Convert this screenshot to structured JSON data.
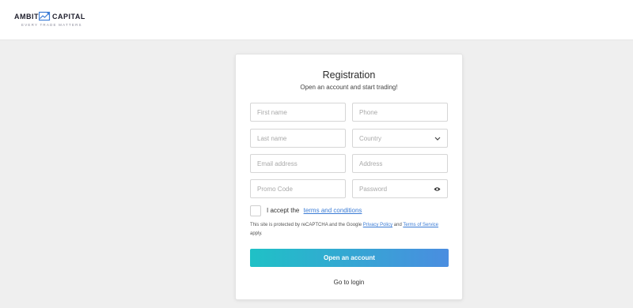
{
  "brand": {
    "name_left": "AMBIT",
    "name_right": "CAPITAL",
    "tagline": "EVERY TRADE MATTERS",
    "logo_icon": "chart-trend-icon",
    "color": "#3a7bd5"
  },
  "form": {
    "title": "Registration",
    "subtitle": "Open an account and start trading!",
    "fields": {
      "first_name": {
        "placeholder": "First name",
        "value": ""
      },
      "phone": {
        "placeholder": "Phone",
        "value": ""
      },
      "last_name": {
        "placeholder": "Last name",
        "value": ""
      },
      "country": {
        "selected": "Country",
        "icon": "chevron-down-icon"
      },
      "email": {
        "placeholder": "Email address",
        "value": ""
      },
      "address": {
        "placeholder": "Address",
        "value": ""
      },
      "promo": {
        "placeholder": "Promo Code",
        "value": ""
      },
      "password": {
        "placeholder": "Password",
        "value": "",
        "icon": "eye-icon"
      }
    },
    "terms": {
      "prefix": "I accept the",
      "link": "terms and conditions",
      "checked": false
    },
    "recaptcha": {
      "prefix": "This site is protected by reCAPTCHA and the Google",
      "privacy_link": "Privacy Policy",
      "and": "and",
      "terms_link": "Terms of Service",
      "suffix": "apply."
    },
    "submit_label": "Open an account",
    "login_label": "Go to login"
  },
  "colors": {
    "button_gradient_start": "#1fc1c6",
    "button_gradient_end": "#4a8de0",
    "link": "#3a7bd5",
    "background": "#efefef"
  }
}
